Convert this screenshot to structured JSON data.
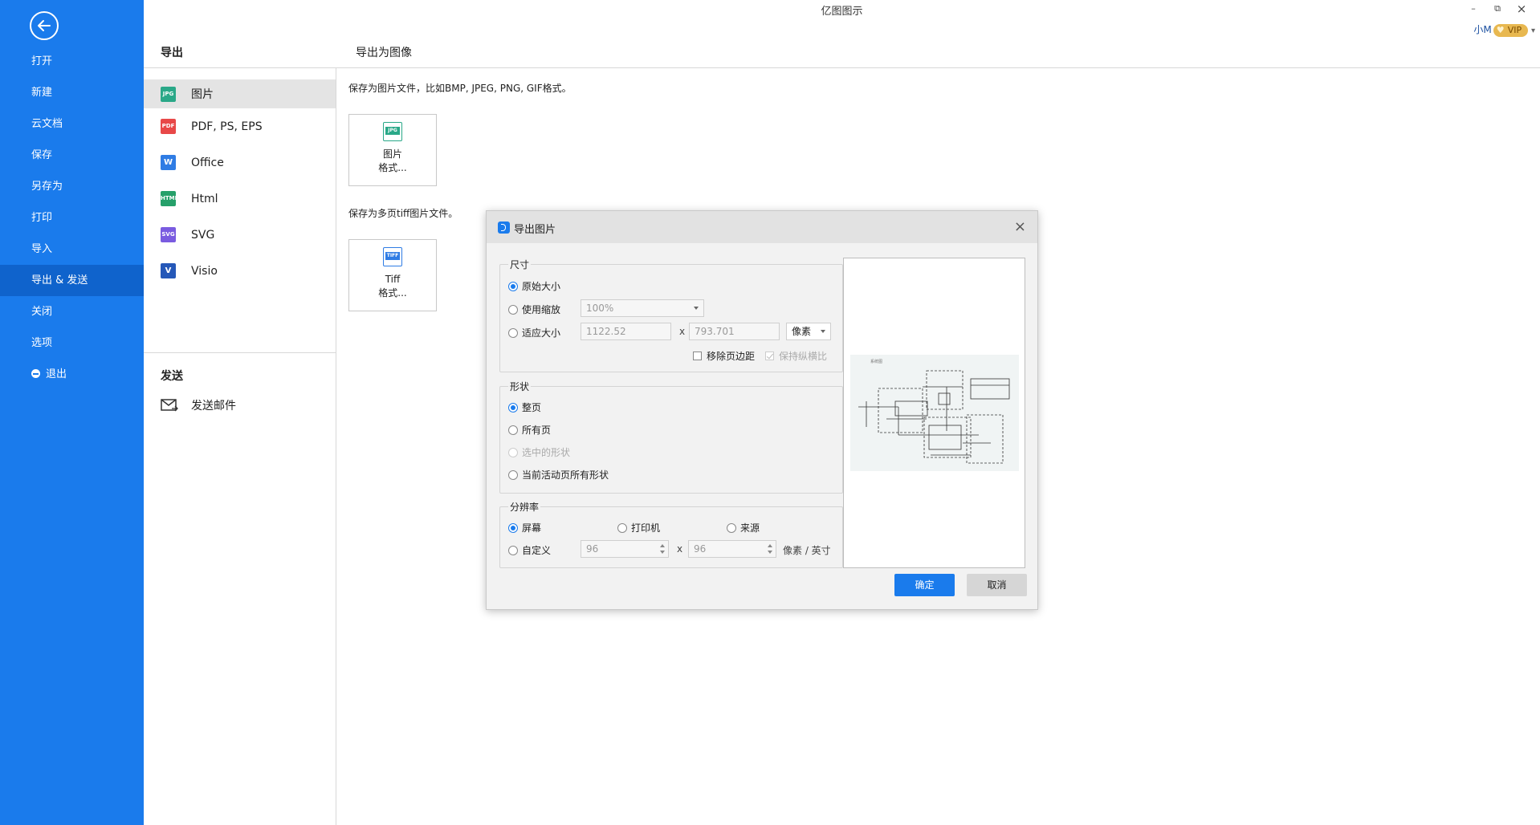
{
  "app": {
    "title": "亿图图示"
  },
  "window": {
    "minimize": "–",
    "restore": "⧉",
    "close": "×"
  },
  "user": {
    "name": "小M",
    "badge": "VIP",
    "caret": "▾"
  },
  "nav": {
    "back_icon": "arrow-left-icon",
    "items": [
      {
        "label": "打开"
      },
      {
        "label": "新建"
      },
      {
        "label": "云文档"
      },
      {
        "label": "保存"
      },
      {
        "label": "另存为"
      },
      {
        "label": "打印"
      },
      {
        "label": "导入"
      },
      {
        "label": "导出 & 发送"
      },
      {
        "label": "关闭"
      },
      {
        "label": "选项"
      },
      {
        "label": "退出"
      }
    ]
  },
  "export": {
    "heading": "导出",
    "formats": [
      {
        "label": "图片",
        "icon_text": "JPG"
      },
      {
        "label": "PDF, PS, EPS",
        "icon_text": "PDF"
      },
      {
        "label": "Office",
        "icon_text": "W"
      },
      {
        "label": "Html",
        "icon_text": "HTML"
      },
      {
        "label": "SVG",
        "icon_text": "SVG"
      },
      {
        "label": "Visio",
        "icon_text": "V"
      }
    ],
    "send_heading": "发送",
    "send_item": "发送邮件"
  },
  "content": {
    "heading": "导出为图像",
    "desc_image": "保存为图片文件，比如BMP, JPEG, PNG, GIF格式。",
    "tile_image": {
      "icon_text": "JPG",
      "line1": "图片",
      "line2": "格式..."
    },
    "desc_tiff": "保存为多页tiff图片文件。",
    "tile_tiff": {
      "icon_text": "TIFF",
      "line1": "Tiff",
      "line2": "格式..."
    }
  },
  "dialog": {
    "title": "导出图片",
    "size": {
      "label": "尺寸",
      "original": "原始大小",
      "use_zoom": "使用缩放",
      "zoom_value": "100%",
      "fit": "适应大小",
      "width": "1122.52",
      "x": "x",
      "height": "793.701",
      "unit": "像素",
      "remove_margin": "移除页边距",
      "keep_ratio": "保持纵横比"
    },
    "shape": {
      "label": "形状",
      "whole_page": "整页",
      "all_pages": "所有页",
      "selected": "选中的形状",
      "current_page_all": "当前活动页所有形状"
    },
    "resolution": {
      "label": "分辨率",
      "screen": "屏幕",
      "printer": "打印机",
      "source": "来源",
      "custom": "自定义",
      "dpi_x": "96",
      "x": "x",
      "dpi_y": "96",
      "unit": "像素 / 英寸"
    },
    "ok": "确定",
    "cancel": "取消",
    "close": "×"
  },
  "colors": {
    "nav_bg": "#1a7bec",
    "nav_active": "#0f63cc",
    "primary": "#1a7bec"
  }
}
